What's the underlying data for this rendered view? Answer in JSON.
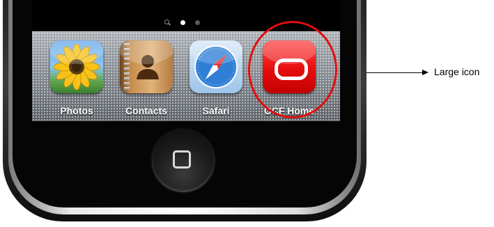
{
  "dock": {
    "apps": [
      {
        "label": "Photos",
        "icon": "photos-icon"
      },
      {
        "label": "Contacts",
        "icon": "contacts-icon"
      },
      {
        "label": "Safari",
        "icon": "safari-icon"
      },
      {
        "label": "OCF Home",
        "icon": "ocf-home-icon"
      }
    ]
  },
  "page_indicator": {
    "pages": 2,
    "active_page": 1
  },
  "annotation": {
    "label": "Large icon"
  },
  "colors": {
    "highlight": "#e30d0d",
    "ocf_icon": "#e60d0d",
    "annotation_text": "#000000"
  }
}
